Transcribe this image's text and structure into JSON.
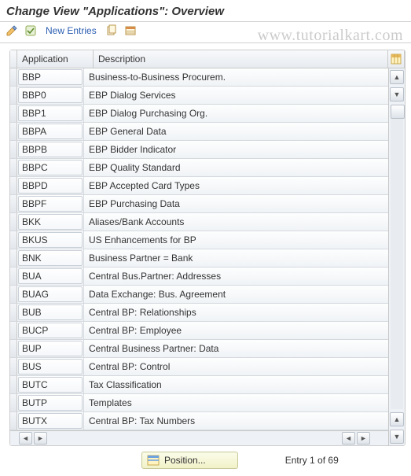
{
  "title": "Change View \"Applications\": Overview",
  "toolbar": {
    "new_entries_label": "New Entries"
  },
  "grid": {
    "headers": {
      "application": "Application",
      "description": "Description"
    },
    "rows": [
      {
        "app": "BBP",
        "desc": "Business-to-Business Procurem."
      },
      {
        "app": "BBP0",
        "desc": "EBP Dialog Services"
      },
      {
        "app": "BBP1",
        "desc": "EBP Dialog Purchasing Org."
      },
      {
        "app": "BBPA",
        "desc": "EBP General Data"
      },
      {
        "app": "BBPB",
        "desc": "EBP Bidder Indicator"
      },
      {
        "app": "BBPC",
        "desc": "EBP Quality Standard"
      },
      {
        "app": "BBPD",
        "desc": "EBP Accepted Card Types"
      },
      {
        "app": "BBPF",
        "desc": "EBP Purchasing Data"
      },
      {
        "app": "BKK",
        "desc": "Aliases/Bank Accounts"
      },
      {
        "app": "BKUS",
        "desc": "US Enhancements for BP"
      },
      {
        "app": "BNK",
        "desc": "Business Partner = Bank"
      },
      {
        "app": "BUA",
        "desc": "Central Bus.Partner: Addresses"
      },
      {
        "app": "BUAG",
        "desc": "Data Exchange: Bus. Agreement"
      },
      {
        "app": "BUB",
        "desc": "Central BP: Relationships"
      },
      {
        "app": "BUCP",
        "desc": "Central BP: Employee"
      },
      {
        "app": "BUP",
        "desc": "Central Business Partner: Data"
      },
      {
        "app": "BUS",
        "desc": "Central BP: Control"
      },
      {
        "app": "BUTC",
        "desc": "Tax Classification"
      },
      {
        "app": "BUTP",
        "desc": "Templates"
      },
      {
        "app": "BUTX",
        "desc": "Central BP: Tax Numbers"
      }
    ]
  },
  "footer": {
    "position_label": "Position...",
    "entry_status": "Entry 1 of 69"
  },
  "watermark": "www.tutorialkart.com"
}
